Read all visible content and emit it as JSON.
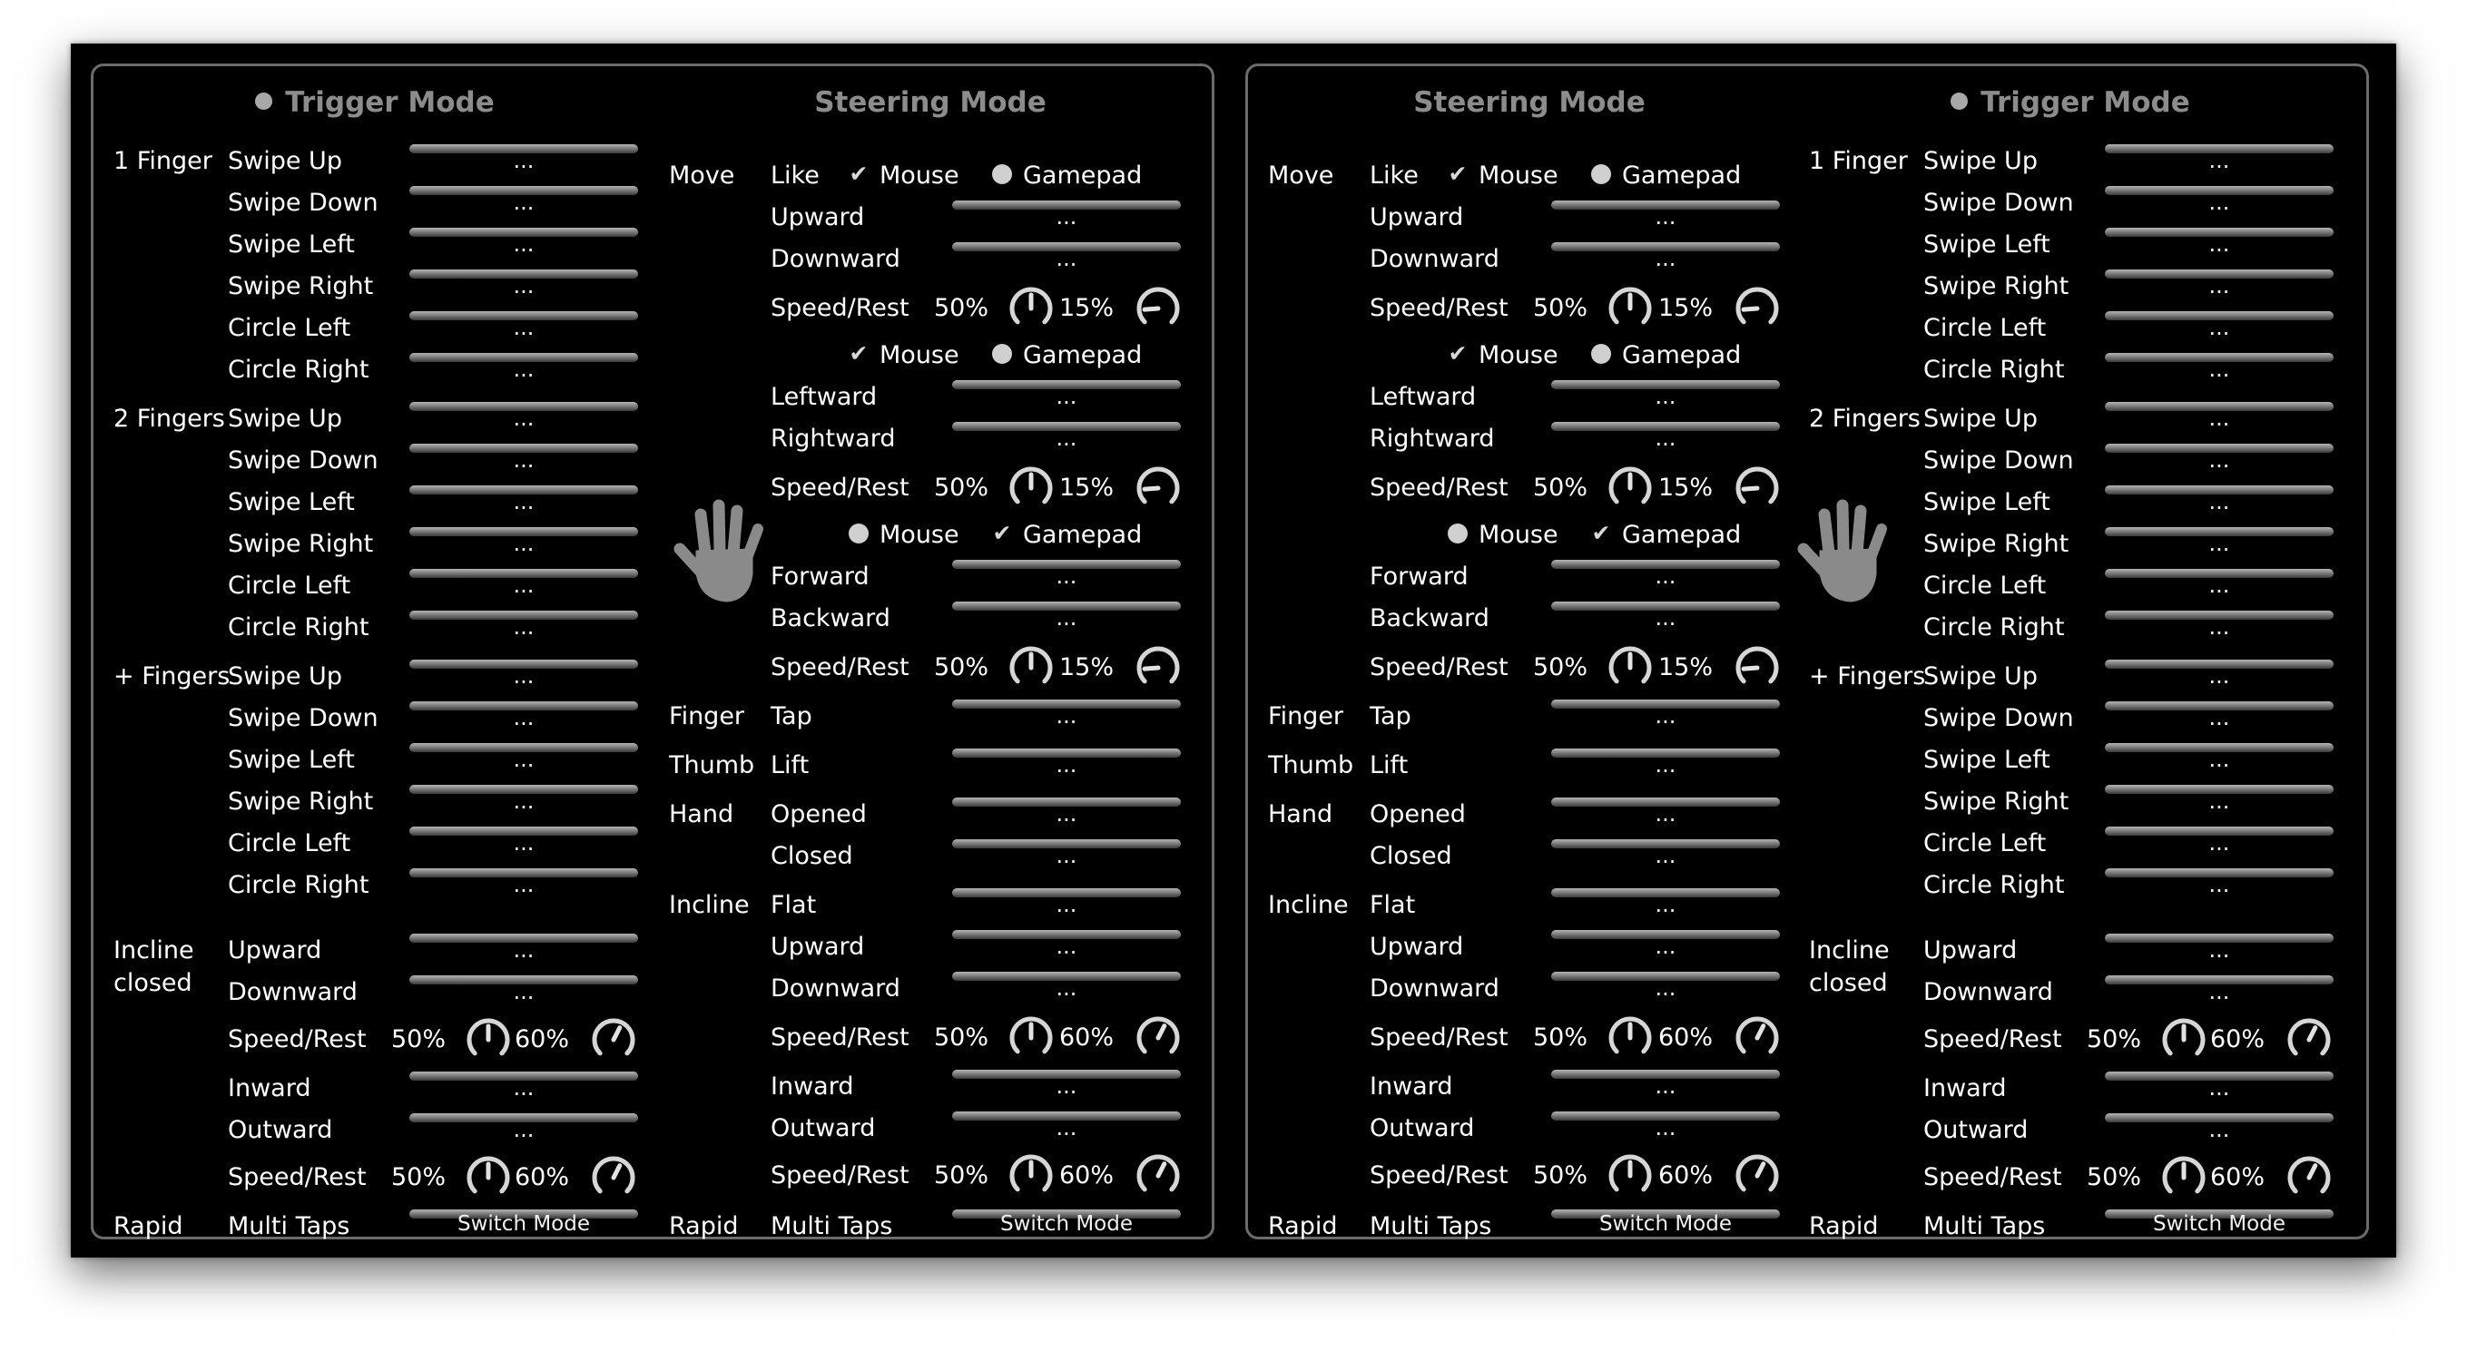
{
  "trigger": {
    "title": "Trigger Mode",
    "groups": [
      {
        "label": [
          "1 Finger"
        ],
        "items": [
          "Swipe Up",
          "Swipe Down",
          "Swipe Left",
          "Swipe Right",
          "Circle Left",
          "Circle Right"
        ]
      },
      {
        "label": [
          "2 Fingers"
        ],
        "items": [
          "Swipe Up",
          "Swipe Down",
          "Swipe Left",
          "Swipe Right",
          "Circle Left",
          "Circle Right"
        ]
      },
      {
        "label": [
          "+ Fingers"
        ],
        "items": [
          "Swipe Up",
          "Swipe Down",
          "Swipe Left",
          "Swipe Right",
          "Circle Left",
          "Circle Right"
        ]
      }
    ],
    "incline": {
      "label": [
        "Incline",
        "closed"
      ],
      "items": [
        "Upward",
        "Downward",
        "Speed/Rest",
        "Inward",
        "Outward",
        "Speed/Rest"
      ],
      "knobs": [
        {
          "speed": "50%",
          "rest": "60%"
        },
        {
          "speed": "50%",
          "rest": "60%"
        }
      ]
    },
    "rapid": {
      "label": "Rapid",
      "item": "Multi Taps",
      "button": "Switch Mode"
    }
  },
  "steering": {
    "title": "Steering Mode",
    "move_label": "Move",
    "move_like": "Like",
    "move_blocks": [
      {
        "radio": "mouse",
        "items": [
          "Upward",
          "Downward"
        ],
        "speed_label": "Speed/Rest",
        "speed": "50%",
        "rest": "15%"
      },
      {
        "radio": "mouse",
        "items": [
          "Leftward",
          "Rightward"
        ],
        "speed_label": "Speed/Rest",
        "speed": "50%",
        "rest": "15%"
      },
      {
        "radio": "gamepad",
        "items": [
          "Forward",
          "Backward"
        ],
        "speed_label": "Speed/Rest",
        "speed": "50%",
        "rest": "15%"
      }
    ],
    "radio_labels": {
      "mouse": "Mouse",
      "gamepad": "Gamepad"
    },
    "finger": {
      "label": "Finger",
      "item": "Tap"
    },
    "thumb": {
      "label": "Thumb",
      "item": "Lift"
    },
    "hand": {
      "label": "Hand",
      "items": [
        "Opened",
        "Closed"
      ]
    },
    "incline": {
      "label": "Incline",
      "items": [
        "Flat",
        "Upward",
        "Downward",
        "Speed/Rest",
        "Inward",
        "Outward",
        "Speed/Rest"
      ],
      "knobs": [
        {
          "speed": "50%",
          "rest": "60%"
        },
        {
          "speed": "50%",
          "rest": "60%"
        }
      ]
    },
    "rapid": {
      "label": "Rapid",
      "item": "Multi Taps",
      "button": "Switch Mode"
    }
  },
  "placeholder": "...",
  "colors": {
    "background": "#000000",
    "border": "#6b6b6b",
    "header": "#8c8c8c",
    "text": "#ffffff"
  }
}
